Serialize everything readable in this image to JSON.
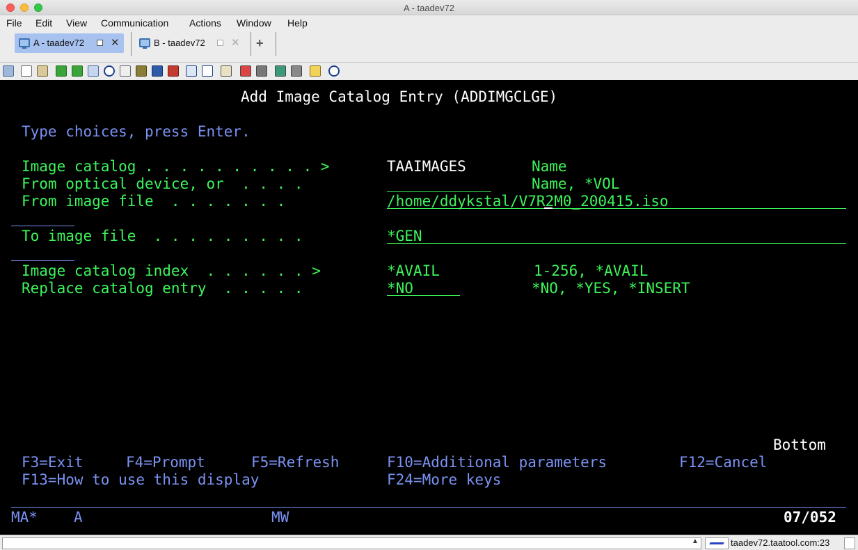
{
  "window": {
    "title": "A - taadev72"
  },
  "menu": [
    "File",
    "Edit",
    "View",
    "Communication",
    "Actions",
    "Window",
    "Help"
  ],
  "tabs": [
    {
      "label": "A - taadev72",
      "active": true
    },
    {
      "label": "B - taadev72",
      "active": false
    }
  ],
  "tabbar": {
    "add": "+"
  },
  "toolbar_icons": [
    "copy-icon",
    "paste-icon",
    "clipboard-icon",
    "send-file-icon",
    "receive-file-icon",
    "print-icon",
    "compass-icon",
    "list-icon",
    "macro-icon",
    "settings-icon",
    "record-icon",
    "keyboard-icon",
    "grid-icon",
    "tools-icon",
    "connect-icon",
    "disconnect-icon",
    "play-icon",
    "stop-icon",
    "notes-icon",
    "help-icon"
  ],
  "screen": {
    "title": "Add Image Catalog Entry (ADDIMGCLGE)",
    "instruction": "Type choices, press Enter.",
    "rows": [
      {
        "label": "Image catalog . . . . . . . . . . >",
        "value": "TAAIMAGES",
        "hint": "Name"
      },
      {
        "label": "From optical device, or  . . . .",
        "value": "",
        "hint": "Name, *VOL"
      },
      {
        "label": "From image file  . . . . . . .",
        "value": "/home/ddykstal/V7R2M0_200415.iso",
        "hint": ""
      },
      {
        "label": "To image file  . . . . . . . . .",
        "value": "*GEN",
        "hint": ""
      },
      {
        "label": "Image catalog index  . . . . . . >",
        "value": "*AVAIL",
        "hint": "1-256, *AVAIL"
      },
      {
        "label": "Replace catalog entry  . . . . .",
        "value": "*NO",
        "hint": "*NO, *YES, *INSERT"
      }
    ],
    "bottom": "Bottom",
    "fkeys_line1": [
      "F3=Exit",
      "F4=Prompt",
      "F5=Refresh",
      "F10=Additional parameters",
      "F12=Cancel"
    ],
    "fkeys_line2": [
      "F13=How to use this display",
      "F24=More keys"
    ],
    "oia": {
      "ma": "MA*",
      "session": "A",
      "mw": "MW",
      "cursor_pos": "07/052"
    }
  },
  "status": {
    "host": "taadev72.taatool.com:23"
  },
  "colors": {
    "green": "#3cf55a",
    "blue": "#7b92f2",
    "white": "#ffffff",
    "background": "#000000"
  }
}
